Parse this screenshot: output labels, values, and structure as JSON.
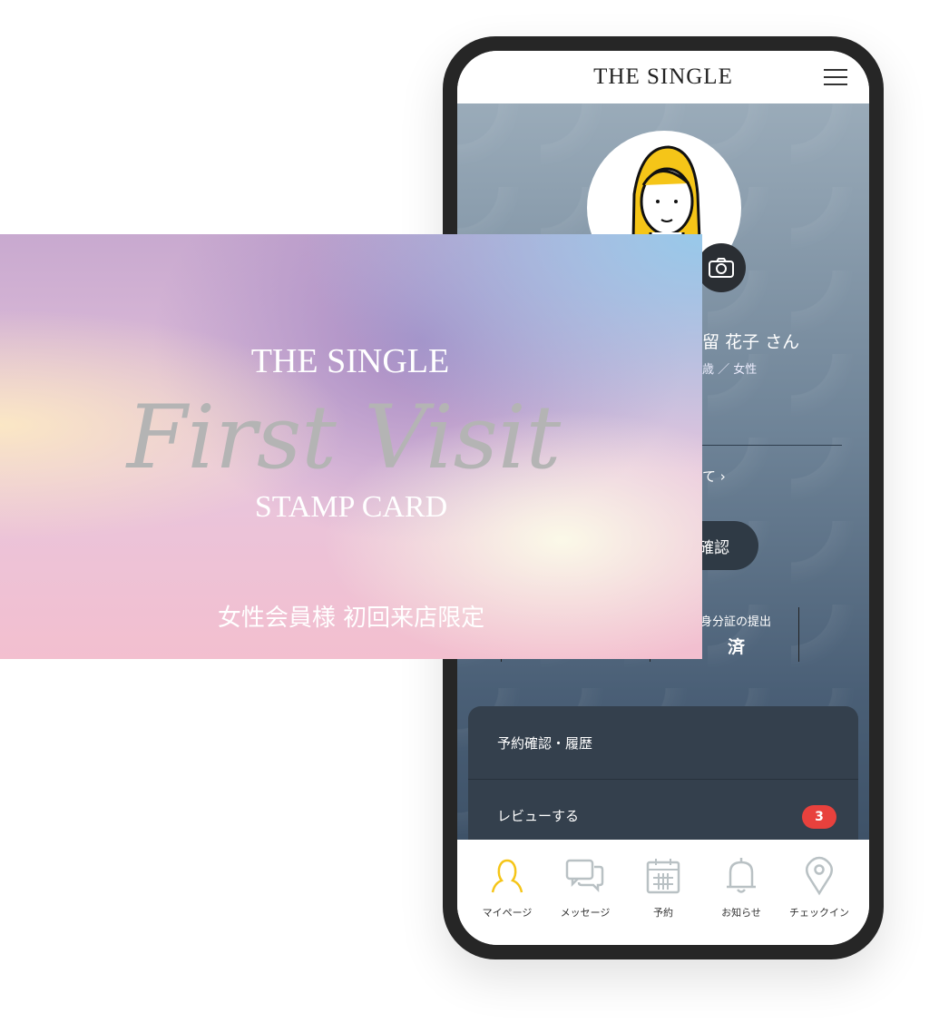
{
  "header": {
    "logo": "THE SINGLE",
    "menu_icon": "hamburger-icon"
  },
  "profile": {
    "name": "留 花子 さん",
    "sub": "歳 ／ 女性",
    "link": "て  ›",
    "button": "確認",
    "id_label": "身分証の提出",
    "id_value": "済"
  },
  "menu": [
    {
      "label": "予約確認・履歴"
    },
    {
      "label": "レビューする",
      "badge": "3"
    }
  ],
  "nav": [
    {
      "label": "マイページ",
      "icon": "person-icon",
      "active": true
    },
    {
      "label": "メッセージ",
      "icon": "chat-icon"
    },
    {
      "label": "予約",
      "icon": "calendar-icon"
    },
    {
      "label": "お知らせ",
      "icon": "bell-icon"
    },
    {
      "label": "チェックイン",
      "icon": "location-pin-icon"
    }
  ],
  "card": {
    "logo": "THE SINGLE",
    "script": "First Visit",
    "title": "STAMP CARD",
    "note": "女性会員様 初回来店限定"
  },
  "colors": {
    "accent": "#f5c518",
    "badge": "#e8413d",
    "nav_icon": "#b9c1c4"
  }
}
